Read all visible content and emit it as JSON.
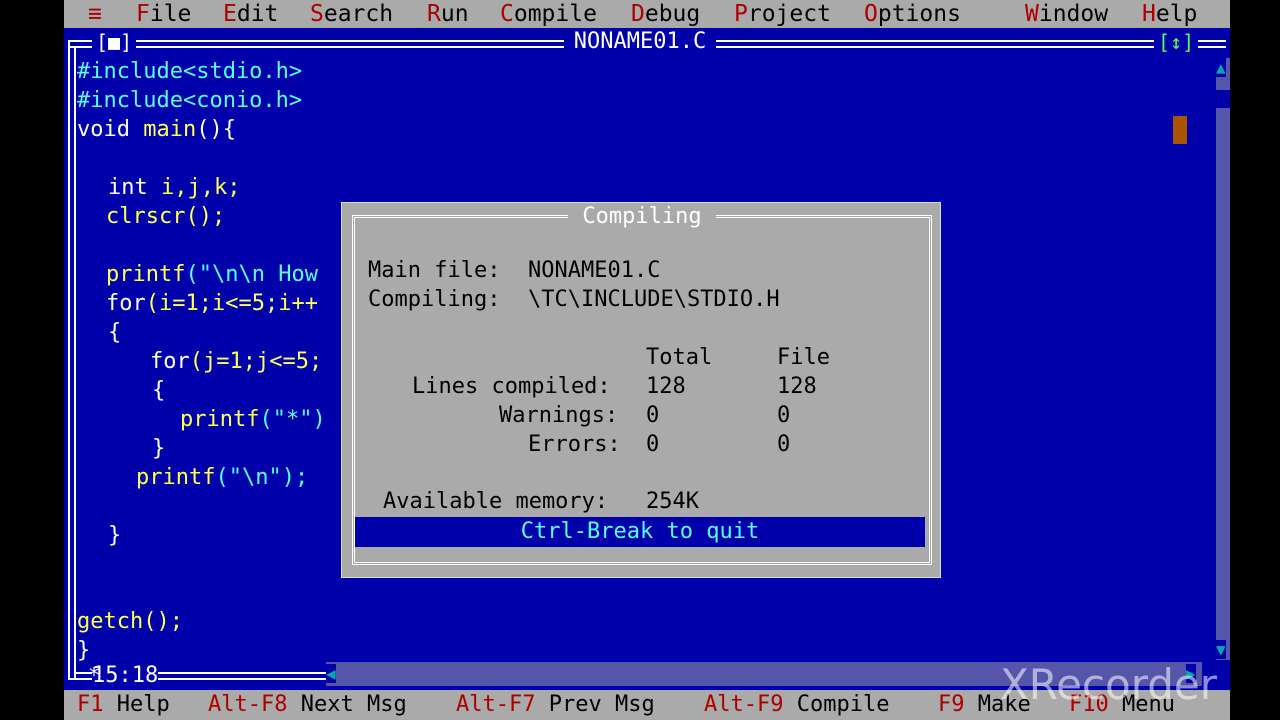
{
  "menu": {
    "system": "≡",
    "items": [
      {
        "hot": "F",
        "rest": "ile"
      },
      {
        "hot": "E",
        "rest": "dit"
      },
      {
        "hot": "S",
        "rest": "earch"
      },
      {
        "hot": "R",
        "rest": "un"
      },
      {
        "hot": "C",
        "rest": "ompile"
      },
      {
        "hot": "D",
        "rest": "ebug"
      },
      {
        "hot": "P",
        "rest": "roject"
      },
      {
        "hot": "O",
        "rest": "ptions"
      },
      {
        "hot": "W",
        "rest": "indow"
      },
      {
        "hot": "H",
        "rest": "elp"
      }
    ]
  },
  "window": {
    "title": "NONAME01.C",
    "close_glyph": "[■]",
    "zoom_glyph": "[↕]",
    "position": "15:18"
  },
  "code": {
    "l1": "#include<stdio.h>",
    "l2": "#include<conio.h>",
    "l3a": "void ",
    "l3b": "main",
    "l3c": "(){",
    "l4a": "int ",
    "l4b": "i,j,k;",
    "l5": "clrscr();",
    "l6a": "printf",
    "l6b": "(\"\\n\\n How",
    "l7a": "for",
    "l7b": "(i=1;i<=5;i++",
    "l8": "{",
    "l9a": "for",
    "l9b": "(j=1;j<=5;",
    "l10": "{",
    "l11a": "printf",
    "l11b": "(\"*\")",
    "l12": "}",
    "l13a": "printf",
    "l13b": "(\"\\n\");",
    "l14": "}",
    "l15": "getch();",
    "l16": "}"
  },
  "dialog": {
    "title": "Compiling",
    "main_file_label": "Main file:",
    "main_file": "NONAME01.C",
    "compiling_label": "Compiling:",
    "compiling_file": "\\TC\\INCLUDE\\STDIO.H",
    "col_total": "Total",
    "col_file": "File",
    "rows": [
      {
        "label": "Lines compiled:",
        "total": "128",
        "file": "128"
      },
      {
        "label": "Warnings:",
        "total": "0",
        "file": "0"
      },
      {
        "label": "Errors:",
        "total": "0",
        "file": "0"
      }
    ],
    "memory_label": "Available memory:",
    "memory": "254K",
    "quit": "Ctrl-Break to quit"
  },
  "statusbar": [
    {
      "key": "F1",
      "label": "Help"
    },
    {
      "key": "Alt-F8",
      "label": "Next Msg"
    },
    {
      "key": "Alt-F7",
      "label": "Prev Msg"
    },
    {
      "key": "Alt-F9",
      "label": "Compile"
    },
    {
      "key": "F9",
      "label": "Make"
    },
    {
      "key": "F10",
      "label": "Menu"
    }
  ],
  "watermark": "XRecorder",
  "colors": {
    "background": "#0000aa",
    "menu": "#aaaaaa",
    "hotkey": "#aa0000"
  }
}
